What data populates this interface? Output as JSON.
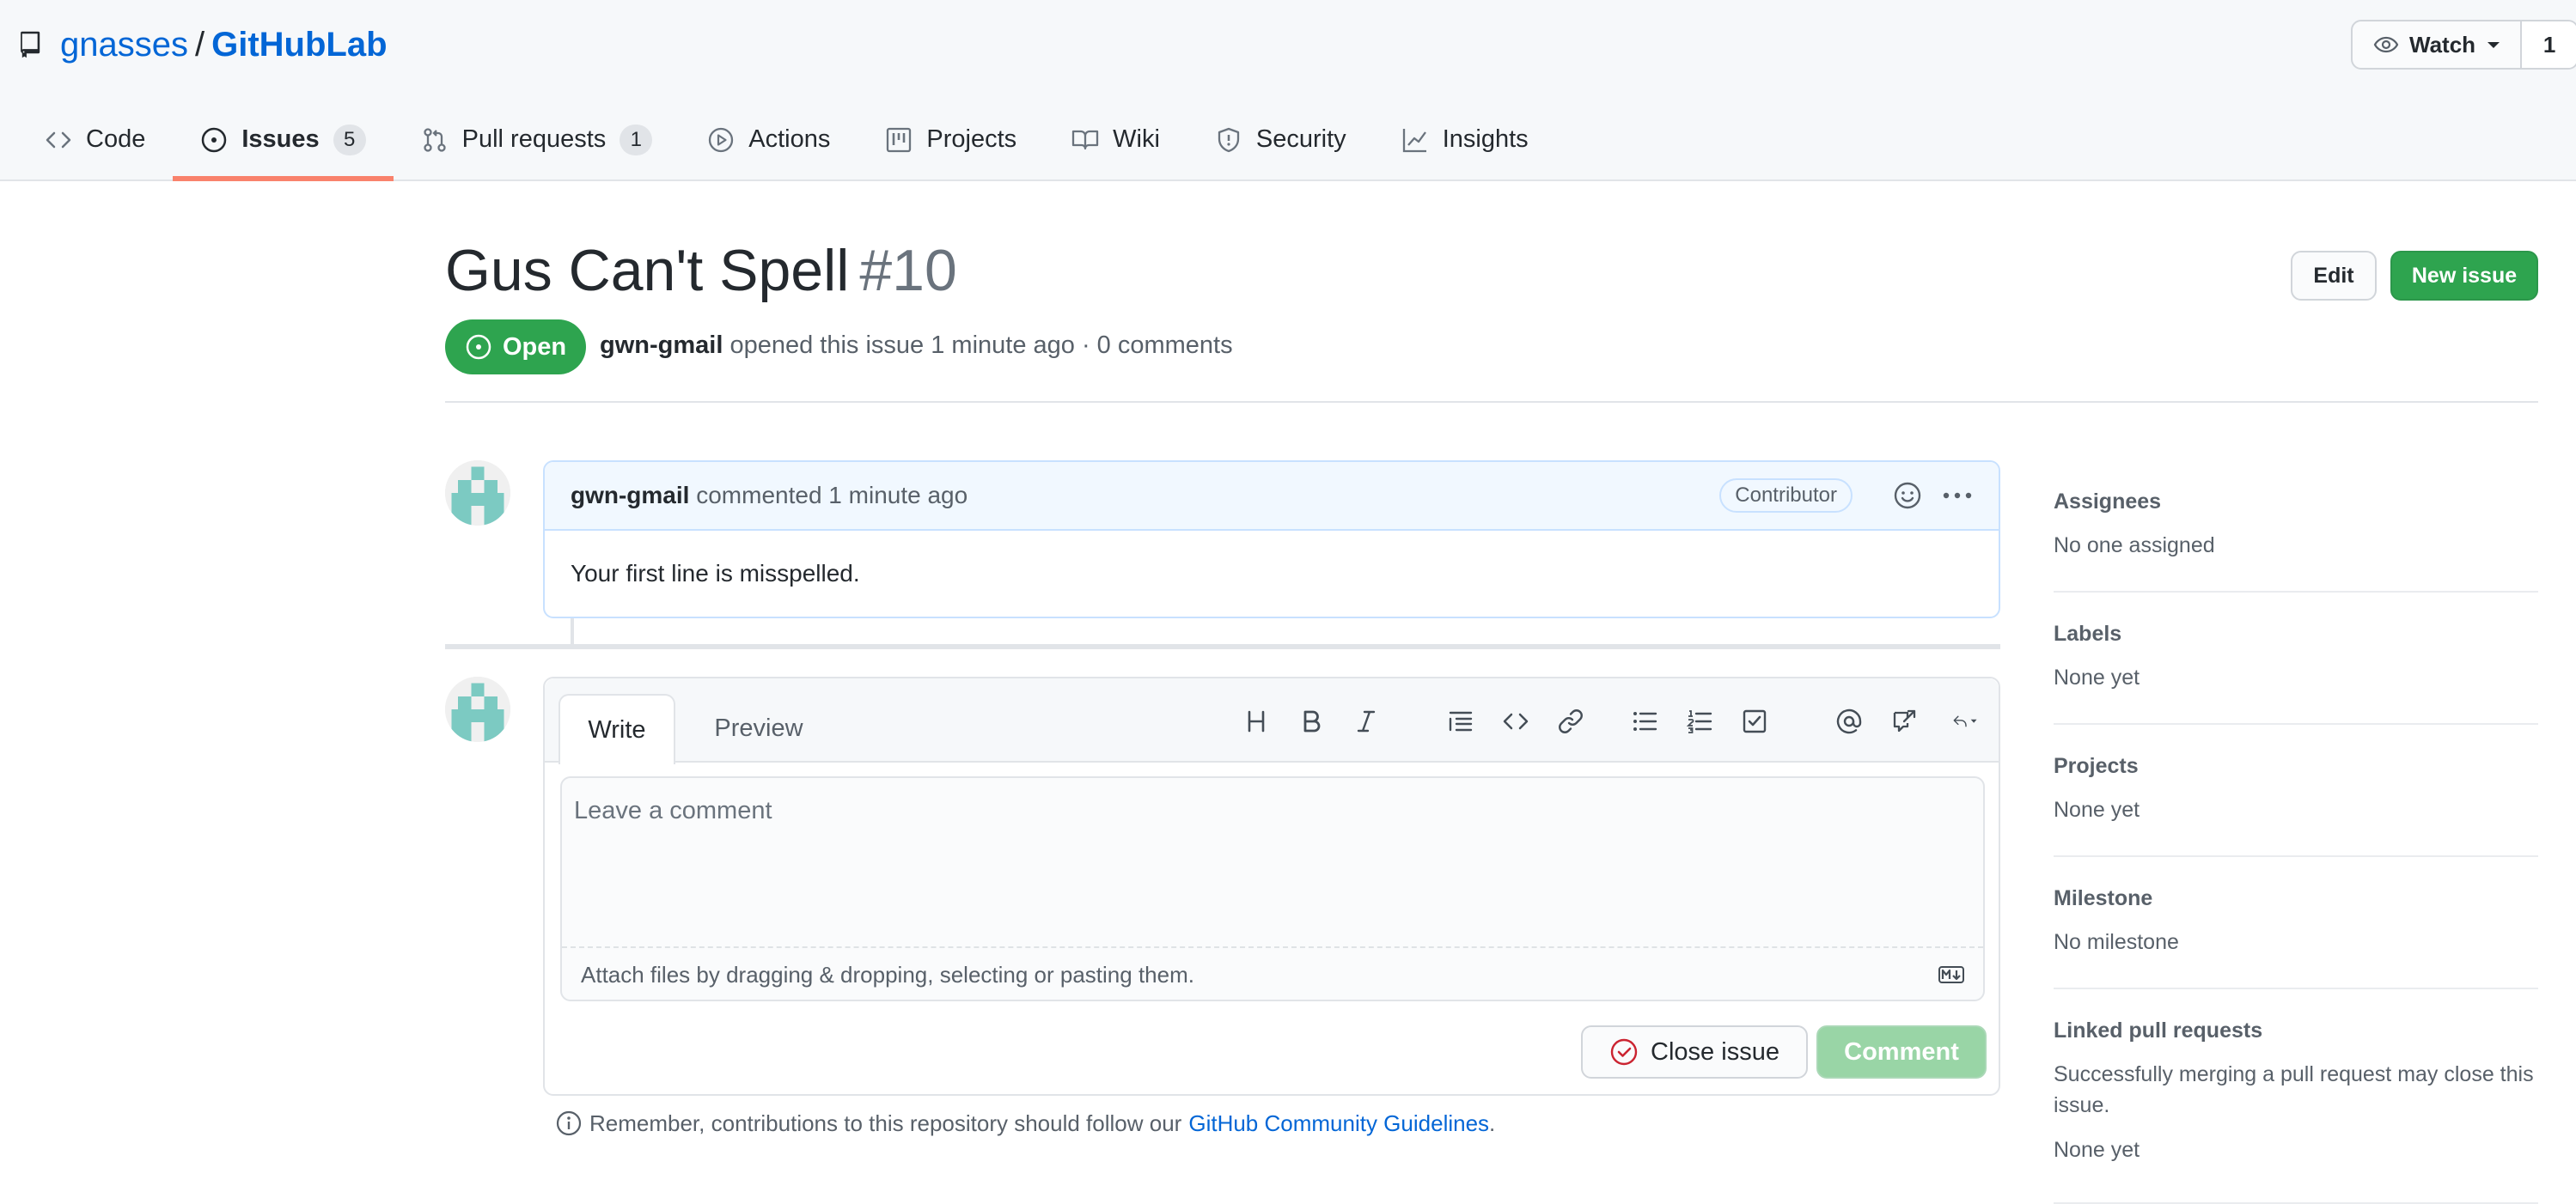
{
  "repo": {
    "owner": "gnasses",
    "separator": "/",
    "name": "GitHubLab",
    "watch_label": "Watch",
    "watch_count": "1"
  },
  "nav": {
    "tabs": [
      {
        "label": "Code",
        "icon": "code-icon"
      },
      {
        "label": "Issues",
        "icon": "issue-opened-icon",
        "count": "5",
        "selected": true
      },
      {
        "label": "Pull requests",
        "icon": "git-pull-request-icon",
        "count": "1"
      },
      {
        "label": "Actions",
        "icon": "play-icon"
      },
      {
        "label": "Projects",
        "icon": "project-icon"
      },
      {
        "label": "Wiki",
        "icon": "book-icon"
      },
      {
        "label": "Security",
        "icon": "shield-icon"
      },
      {
        "label": "Insights",
        "icon": "graph-icon"
      }
    ]
  },
  "issue": {
    "title": "Gus Can't Spell",
    "number": "#10",
    "edit_label": "Edit",
    "new_issue_label": "New issue",
    "state": "Open",
    "author": "gwn-gmail",
    "meta_text": "opened this issue 1 minute ago · 0 comments"
  },
  "comment": {
    "author": "gwn-gmail",
    "action_text": "commented 1 minute ago",
    "role_badge": "Contributor",
    "body": "Your first line is misspelled."
  },
  "composer": {
    "write_tab": "Write",
    "preview_tab": "Preview",
    "placeholder": "Leave a comment",
    "attach_text": "Attach files by dragging & dropping, selecting or pasting them.",
    "close_issue_label": "Close issue",
    "comment_label": "Comment",
    "toolbar_icons": [
      "heading-icon",
      "bold-icon",
      "italic-icon",
      "quote-icon",
      "code-icon",
      "link-icon",
      "unordered-list-icon",
      "ordered-list-icon",
      "task-list-icon",
      "mention-icon",
      "cross-reference-icon",
      "reply-icon"
    ]
  },
  "guidelines": {
    "prefix": "Remember, contributions to this repository should follow our",
    "link": "GitHub Community Guidelines",
    "suffix": "."
  },
  "sidebar": {
    "assignees": {
      "heading": "Assignees",
      "value": "No one assigned"
    },
    "labels": {
      "heading": "Labels",
      "value": "None yet"
    },
    "projects": {
      "heading": "Projects",
      "value": "None yet"
    },
    "milestone": {
      "heading": "Milestone",
      "value": "No milestone"
    },
    "linked_prs": {
      "heading": "Linked pull requests",
      "description": "Successfully merging a pull request may close this issue.",
      "value": "None yet"
    }
  },
  "colors": {
    "open_green": "#2ea44f",
    "link_blue": "#0366d6",
    "tab_underline": "#f9826c",
    "avatar_teal": "#7ccac2"
  }
}
